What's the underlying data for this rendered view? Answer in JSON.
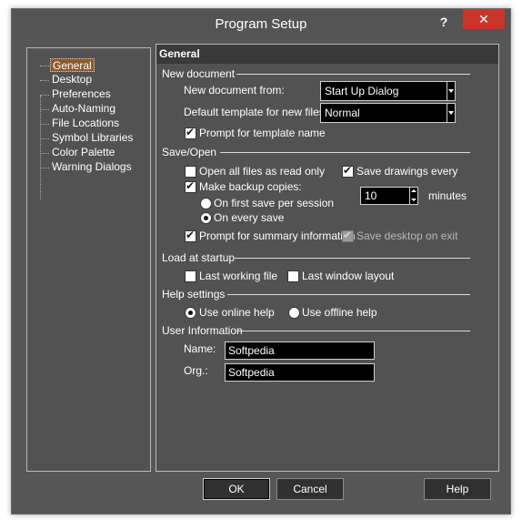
{
  "window": {
    "title": "Program Setup",
    "help_glyph": "?",
    "close_glyph": "✕"
  },
  "tree": {
    "items": [
      "General",
      "Desktop",
      "Preferences",
      "Auto-Naming",
      "File Locations",
      "Symbol Libraries",
      "Color Palette",
      "Warning Dialogs"
    ],
    "selected": "General"
  },
  "panel": {
    "title": "General",
    "new_document": {
      "section": "New document",
      "new_from_label": "New document from:",
      "new_from_value": "Start Up Dialog",
      "default_template_label": "Default template for new files:",
      "default_template_value": "Normal",
      "prompt_template_label": "Prompt for template name",
      "prompt_template_checked": true
    },
    "save_open": {
      "section": "Save/Open",
      "open_readonly_label": "Open all files as read only",
      "open_readonly_checked": false,
      "save_every_label": "Save drawings every",
      "save_every_checked": true,
      "save_every_value": "10",
      "minutes_label": "minutes",
      "backup_label": "Make backup copies:",
      "backup_checked": true,
      "first_save_label": "On first save per session",
      "first_save_selected": false,
      "every_save_label": "On every save",
      "every_save_selected": true,
      "summary_label": "Prompt for summary information",
      "summary_checked": true,
      "save_desktop_label": "Save desktop on exit",
      "save_desktop_checked": true
    },
    "load_startup": {
      "section": "Load at startup",
      "last_file_label": "Last working file",
      "last_file_checked": false,
      "last_layout_label": "Last window layout",
      "last_layout_checked": false
    },
    "help_settings": {
      "section": "Help settings",
      "online_label": "Use online help",
      "online_selected": true,
      "offline_label": "Use offline help",
      "offline_selected": false
    },
    "user_info": {
      "section": "User Information",
      "name_label": "Name:",
      "name_value": "Softpedia",
      "org_label": "Org.:",
      "org_value": "Softpedia"
    }
  },
  "buttons": {
    "ok": "OK",
    "cancel": "Cancel",
    "help": "Help"
  },
  "colors": {
    "window_bg": "#565656",
    "panel_bg": "#525252",
    "panel_header": "#3a3a3a",
    "field_bg": "#000000",
    "close_red": "#c7352a",
    "selection": "#8a5a2c"
  }
}
